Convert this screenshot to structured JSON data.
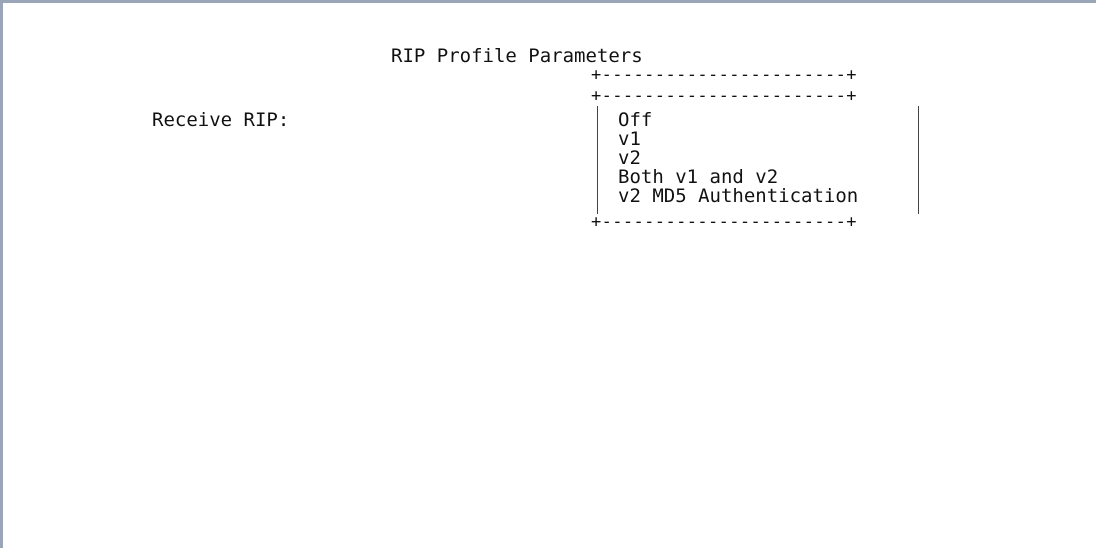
{
  "screen": {
    "title": "RIP Profile Parameters"
  },
  "form": {
    "receive_rip_label": "Receive RIP:"
  },
  "menu": {
    "border_top_outer": "+-----------------------+",
    "border_top_inner": "+-----------------------+",
    "border_bottom": "+-----------------------+",
    "options": [
      "Off",
      "v1",
      "v2",
      "Both v1 and v2",
      "v2 MD5 Authentication"
    ]
  },
  "colors": {
    "frame_border": "#9aa6b8",
    "text": "#111111",
    "background": "#ffffff"
  }
}
